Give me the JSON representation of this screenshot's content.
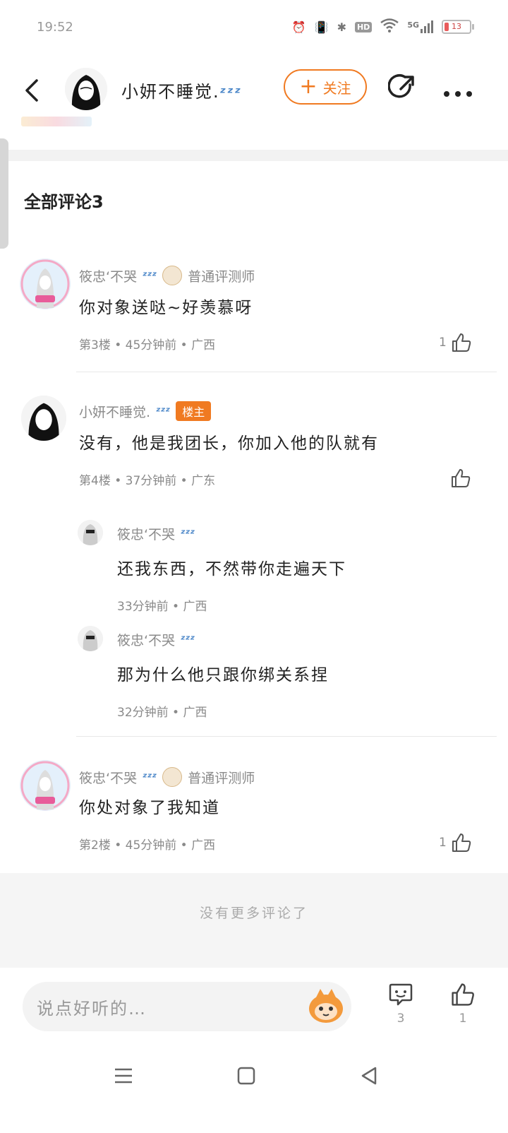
{
  "status": {
    "time": "19:52",
    "network": "5G",
    "hd": "HD",
    "battery": "13"
  },
  "header": {
    "name": "小妍不睡觉.",
    "follow_label": "关注"
  },
  "section": {
    "title": "全部评论3"
  },
  "comments": [
    {
      "user": "筱忠‘不哭",
      "level": "普通评测师",
      "text": "你对象送哒~好羡慕呀",
      "meta": "第3楼 • 45分钟前 • 广西",
      "likes": "1"
    },
    {
      "user": "小妍不睡觉.",
      "owner_badge": "楼主",
      "text": "没有，他是我团长，你加入他的队就有",
      "meta": "第4楼 • 37分钟前 • 广东",
      "replies": [
        {
          "user": "筱忠‘不哭",
          "text": "还我东西，不然带你走遍天下",
          "meta": "33分钟前 • 广西"
        },
        {
          "user": "筱忠‘不哭",
          "text": "那为什么他只跟你绑关系捏",
          "meta": "32分钟前 • 广西"
        }
      ]
    },
    {
      "user": "筱忠‘不哭",
      "level": "普通评测师",
      "text": "你处对象了我知道",
      "meta": "第2楼 • 45分钟前 • 广西",
      "likes": "1"
    }
  ],
  "no_more": "没有更多评论了",
  "input": {
    "placeholder": "说点好听的…"
  },
  "bottom": {
    "comment_count": "3",
    "like_count": "1"
  },
  "colors": {
    "accent": "#f07a21",
    "zzz": "#4a86c8"
  }
}
